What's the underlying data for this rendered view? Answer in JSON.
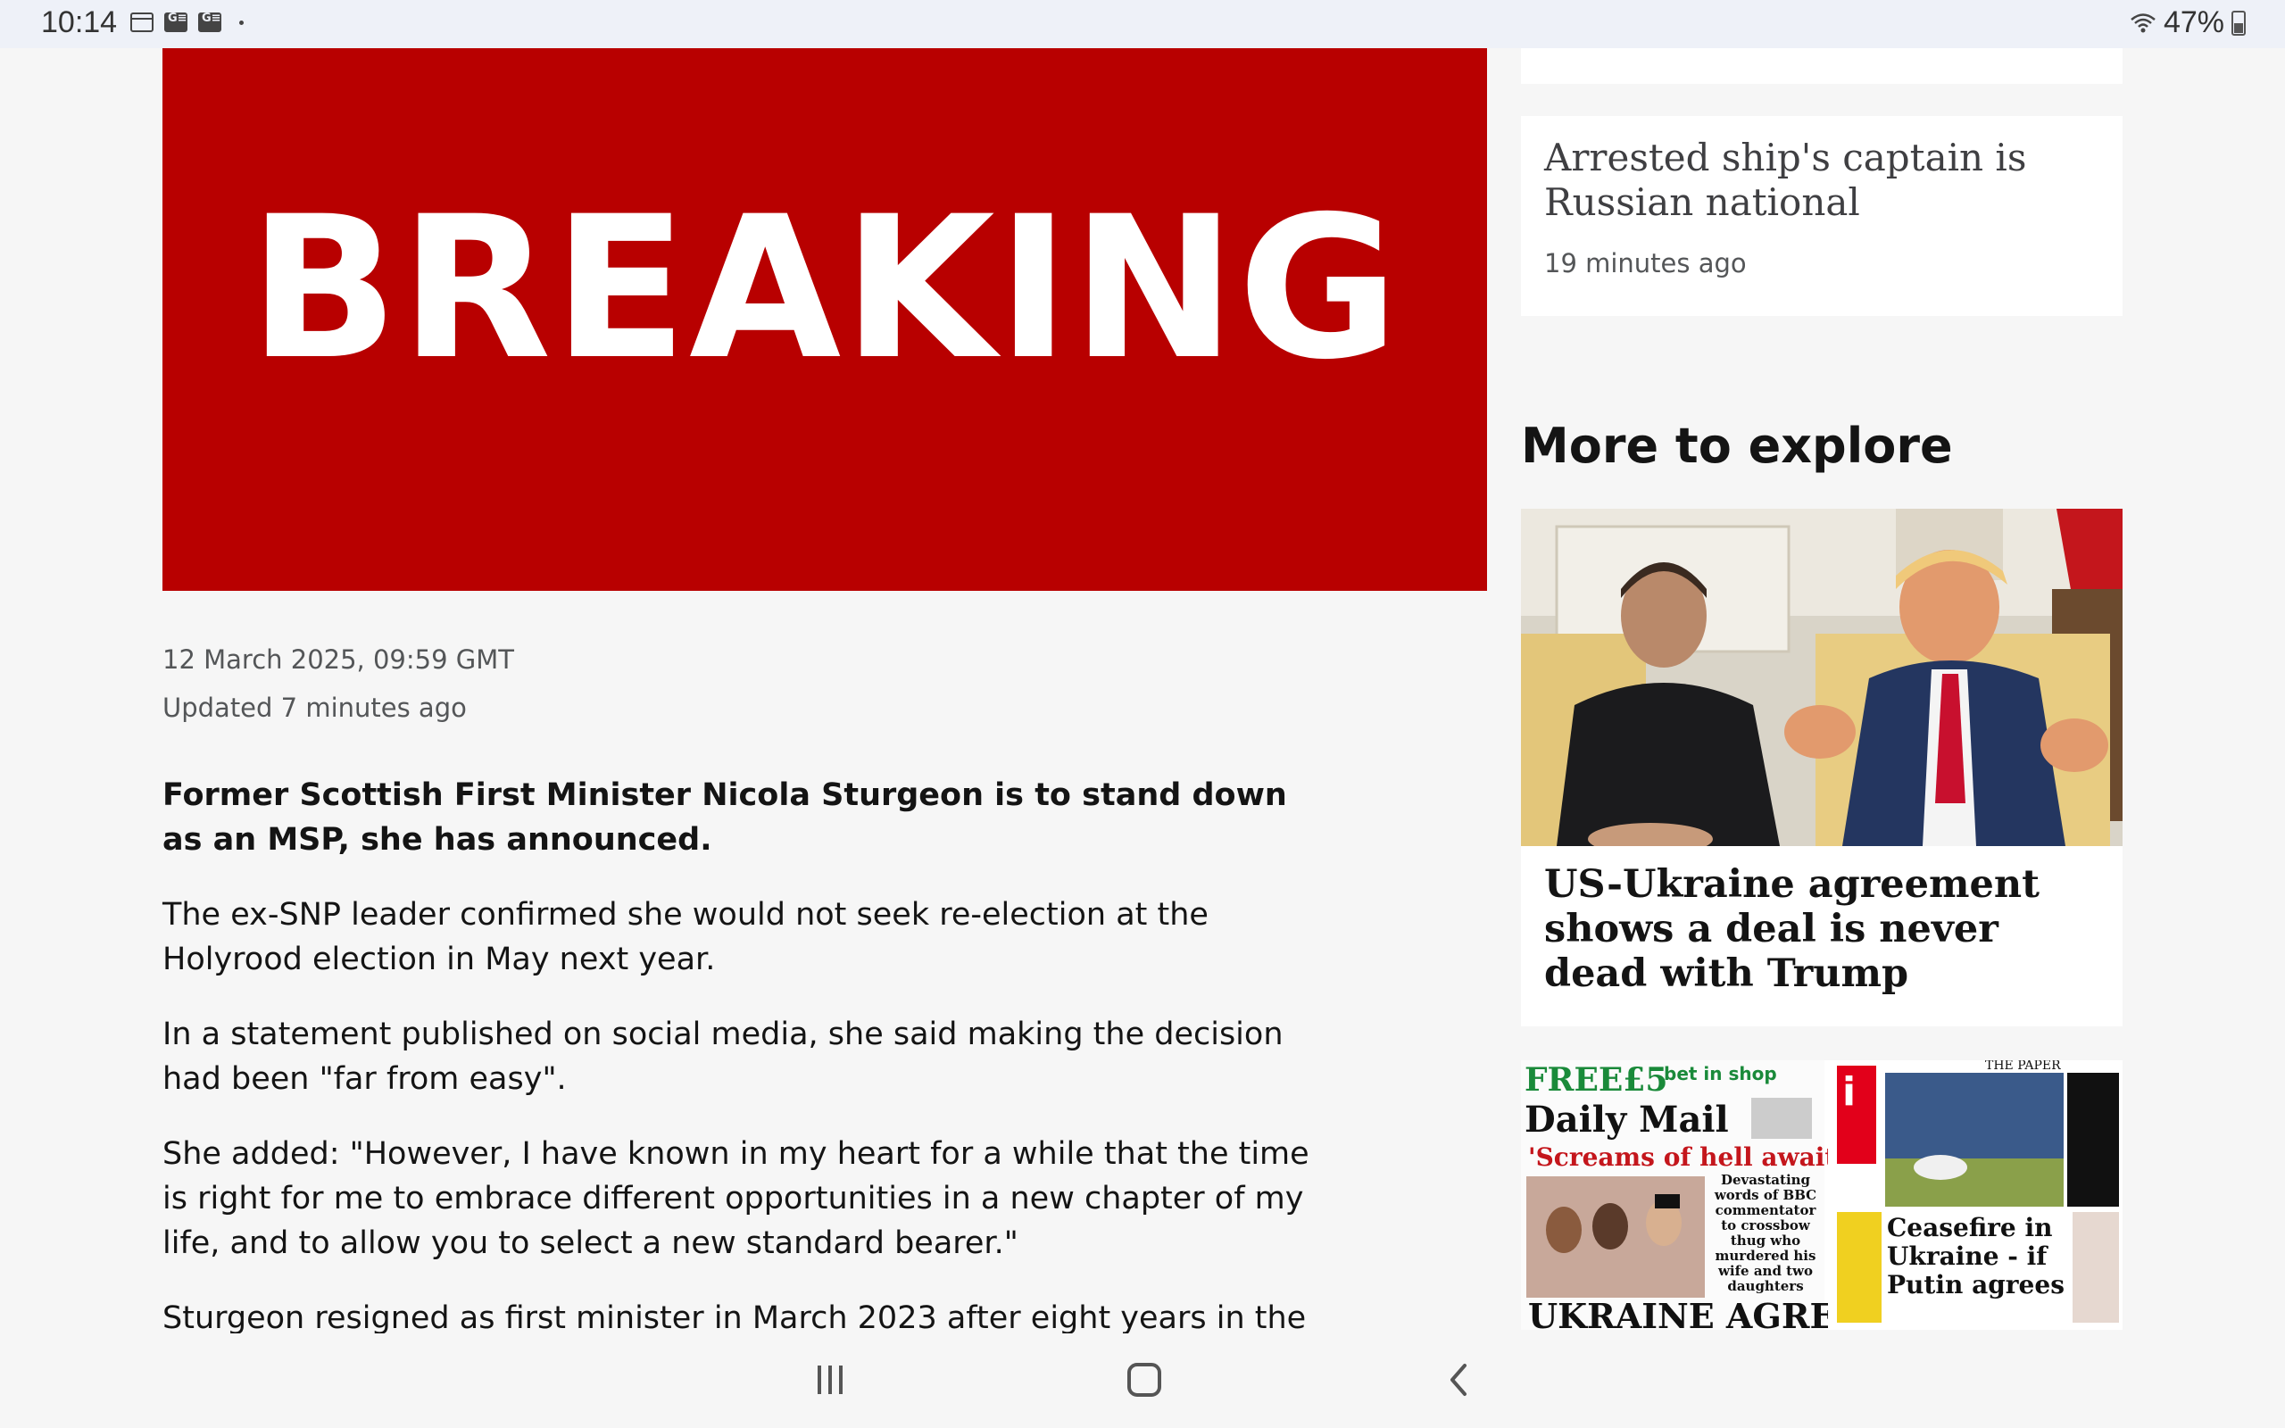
{
  "status_bar": {
    "time": "10:14",
    "battery": "47%",
    "icons_left": [
      "calendar-icon",
      "g-news-icon",
      "g-news-icon",
      "dot-icon"
    ],
    "icons_right": [
      "wifi-icon",
      "battery-icon"
    ]
  },
  "hero": {
    "text": "BREAKING",
    "background": "#b80000"
  },
  "article": {
    "date": "12 March 2025, 09:59 GMT",
    "updated": "Updated 7 minutes ago",
    "paragraphs": [
      "Former Scottish First Minister Nicola Sturgeon is to stand down as an MSP, she has announced.",
      "The ex-SNP leader confirmed she would not seek re-election at the Holyrood election in May next year.",
      "In a statement published on social media, she said making the decision had been \"far from easy\".",
      "She added: \"However, I have known in my heart for a while that the time is right for me to embrace different opportunities in a new chapter of my life, and to allow you to select a new standard bearer.\"",
      "Sturgeon resigned as first minister in March 2023 after eight years in the role"
    ]
  },
  "sidebar": {
    "card": {
      "title": "Arrested ship's captain is Russian national",
      "time": "19 minutes ago"
    },
    "more_heading": "More to explore",
    "promo1": {
      "title": "US-Ukraine agreement shows a deal is never dead with Trump"
    },
    "promo2": {
      "daily_mail": {
        "free": "FREE£5",
        "bet": "bet in shop",
        "masthead": "Daily Mail",
        "headline": "'Screams of hell await you'",
        "subhead": "Devastating words of BBC commentator to crossbow thug who murdered his wife and two daughters",
        "banner": "UKRAINE AGREES"
      },
      "i_paper": {
        "logo": "i",
        "masthead": "THE PAPER",
        "headline": "Ceasefire in Ukraine - if Putin agrees"
      }
    }
  },
  "nav": {
    "buttons": [
      "recents-icon",
      "home-icon",
      "back-icon"
    ]
  }
}
